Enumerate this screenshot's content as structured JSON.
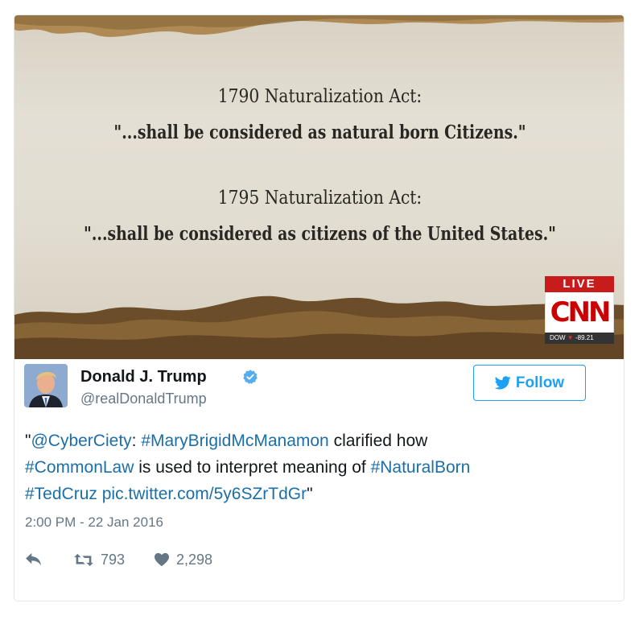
{
  "media": {
    "line1_title": "1790 Naturalization Act:",
    "line1_quote": "\"...shall be considered as natural born Citizens.\"",
    "line2_title": "1795 Naturalization Act:",
    "line2_quote": "\"...shall be considered as citizens of the United States.\"",
    "live_label": "LIVE",
    "network_logo": "CNN",
    "ticker_label": "DOW",
    "ticker_value": "-89.21"
  },
  "author": {
    "display_name": "Donald J. Trump",
    "handle": "@realDonaldTrump",
    "verified_icon": "verified-badge-icon"
  },
  "follow": {
    "label": "Follow",
    "icon": "twitter-bird-icon"
  },
  "tweet": {
    "open_quote": "\"",
    "mention": "@CyberCiety",
    "after_mention": ": ",
    "hashtag1": "#MaryBrigidMcManamon",
    "after_hashtag1": " clarified how ",
    "hashtag2": "#CommonLaw",
    "after_hashtag2": " is used to interpret meaning of ",
    "hashtag3": "#NaturalBorn",
    "hashtag4": "#TedCruz",
    "link": "pic.twitter.com/5y6SZrTdGr",
    "close_quote": "\""
  },
  "timestamp": "2:00 PM - 22 Jan 2016",
  "actions": {
    "reply_icon": "reply-icon",
    "retweet_icon": "retweet-icon",
    "retweet_count": "793",
    "like_icon": "heart-icon",
    "like_count": "2,298"
  },
  "colors": {
    "link": "#1b6fa8",
    "follow": "#1da1f2",
    "meta": "#657786",
    "cnn_red": "#cc0000"
  }
}
